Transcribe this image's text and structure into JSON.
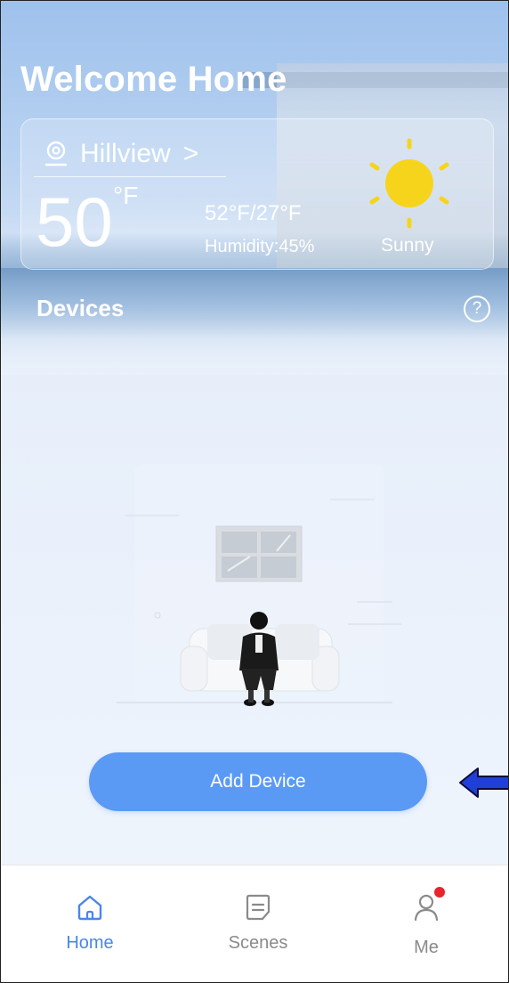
{
  "header": {
    "title": "Welcome Home"
  },
  "weather": {
    "location": "Hillview",
    "location_chevron": ">",
    "temperature": "50",
    "unit": "°F",
    "high_low": "52°F/27°F",
    "humidity": "Humidity:45%",
    "condition": "Sunny",
    "icon": "sun-icon",
    "sun_color": "#f7d41c"
  },
  "devices": {
    "title": "Devices",
    "help": "?",
    "add_button_label": "Add Device"
  },
  "tabs": [
    {
      "label": "Home",
      "icon": "home-icon",
      "active": true
    },
    {
      "label": "Scenes",
      "icon": "scenes-icon",
      "active": false
    },
    {
      "label": "Me",
      "icon": "user-icon",
      "active": false,
      "badge": true
    }
  ],
  "colors": {
    "accent": "#5b9af4",
    "active_tab": "#4a86e8",
    "badge": "#e8242c"
  }
}
